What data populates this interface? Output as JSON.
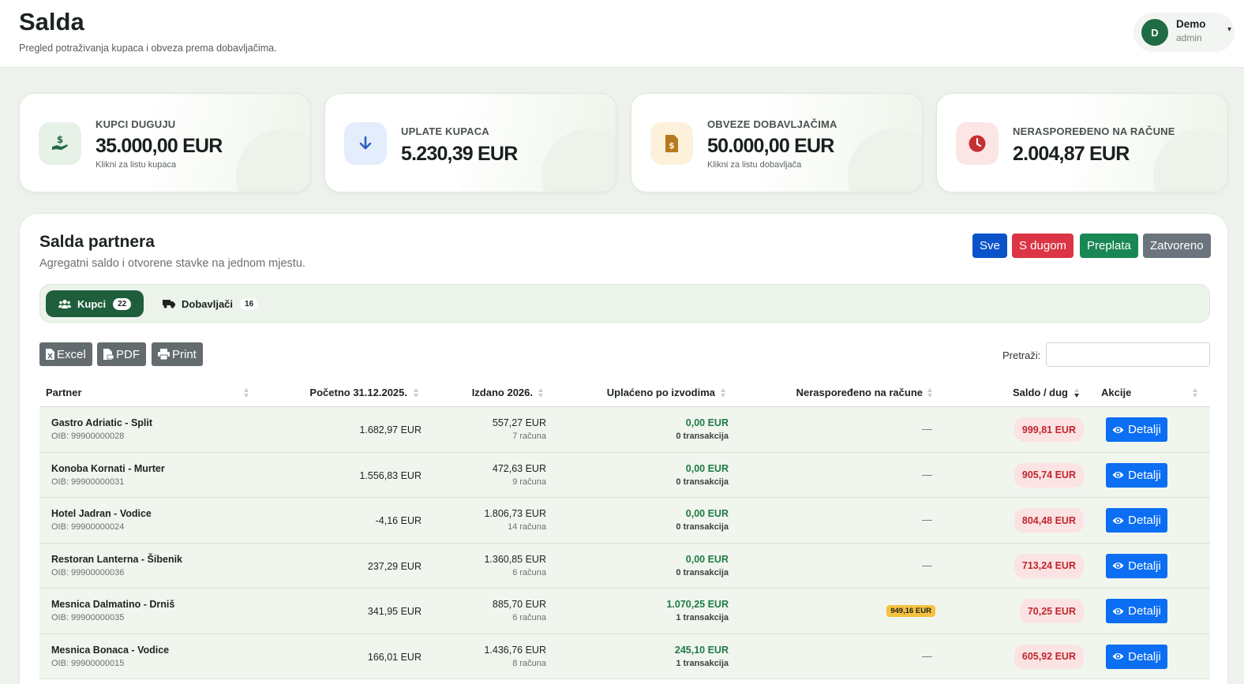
{
  "header": {
    "title": "Salda",
    "subtitle": "Pregled potraživanja kupaca i obveza prema dobavljačima."
  },
  "user": {
    "initial": "D",
    "name": "Demo",
    "role": "admin"
  },
  "stats": [
    {
      "label": "KUPCI DUGUJU",
      "value": "35.000,00 EUR",
      "hint": "Klikni za listu kupaca",
      "icon": "hand-dollar-icon",
      "color": "#1f6b45"
    },
    {
      "label": "UPLATE KUPACA",
      "value": "5.230,39 EUR",
      "hint": "",
      "icon": "arrow-down-icon",
      "color": "#2f5fc4"
    },
    {
      "label": "OBVEZE DOBAVLJAČIMA",
      "value": "50.000,00 EUR",
      "hint": "Klikni za listu dobavljača",
      "icon": "invoice-dollar-icon",
      "color": "#b7791f"
    },
    {
      "label": "NERASPOREĐENO NA RAČUNE",
      "value": "2.004,87 EUR",
      "hint": "",
      "icon": "clock-icon",
      "color": "#c53030"
    }
  ],
  "panel": {
    "title": "Salda partnera",
    "subtitle": "Agregatni saldo i otvorene stavke na jednom mjestu."
  },
  "filters": {
    "all": "Sve",
    "debt": "S dugom",
    "overpaid": "Preplata",
    "closed": "Zatvoreno"
  },
  "tabs": {
    "customers": {
      "label": "Kupci",
      "count": "22"
    },
    "suppliers": {
      "label": "Dobavljači",
      "count": "16"
    }
  },
  "export": {
    "excel": "Excel",
    "pdf": "PDF",
    "print": "Print"
  },
  "search": {
    "label": "Pretraži:",
    "value": ""
  },
  "table": {
    "columns": {
      "partner": "Partner",
      "initial": "Početno 31.12.2025.",
      "issued": "Izdano 2026.",
      "paid": "Uplaćeno po izvodima",
      "unassigned": "Neraspoređeno na račune",
      "saldo": "Saldo / dug",
      "actions": "Akcije"
    },
    "details_label": "Detalji",
    "rows": [
      {
        "name": "Gastro Adriatic - Split",
        "oib": "OIB: 99900000028",
        "initial": "1.682,97 EUR",
        "issued": "557,27 EUR",
        "issued_count": "7 računa",
        "paid": "0,00 EUR",
        "paid_count": "0 transakcija",
        "unassigned": "—",
        "saldo": "999,81 EUR"
      },
      {
        "name": "Konoba Kornati - Murter",
        "oib": "OIB: 99900000031",
        "initial": "1.556,83 EUR",
        "issued": "472,63 EUR",
        "issued_count": "9 računa",
        "paid": "0,00 EUR",
        "paid_count": "0 transakcija",
        "unassigned": "—",
        "saldo": "905,74 EUR"
      },
      {
        "name": "Hotel Jadran - Vodice",
        "oib": "OIB: 99900000024",
        "initial": "-4,16 EUR",
        "issued": "1.806,73 EUR",
        "issued_count": "14 računa",
        "paid": "0,00 EUR",
        "paid_count": "0 transakcija",
        "unassigned": "—",
        "saldo": "804,48 EUR"
      },
      {
        "name": "Restoran Lanterna - Šibenik",
        "oib": "OIB: 99900000036",
        "initial": "237,29 EUR",
        "issued": "1.360,85 EUR",
        "issued_count": "6 računa",
        "paid": "0,00 EUR",
        "paid_count": "0 transakcija",
        "unassigned": "—",
        "saldo": "713,24 EUR"
      },
      {
        "name": "Mesnica Dalmatino - Drniš",
        "oib": "OIB: 99900000035",
        "initial": "341,95 EUR",
        "issued": "885,70 EUR",
        "issued_count": "6 računa",
        "paid": "1.070,25 EUR",
        "paid_count": "1 transakcija",
        "unassigned": "949,16 EUR",
        "saldo": "70,25 EUR"
      },
      {
        "name": "Mesnica Bonaca - Vodice",
        "oib": "OIB: 99900000015",
        "initial": "166,01 EUR",
        "issued": "1.436,76 EUR",
        "issued_count": "8 računa",
        "paid": "245,10 EUR",
        "paid_count": "1 transakcija",
        "unassigned": "—",
        "saldo": "605,92 EUR"
      }
    ]
  },
  "colors": {
    "primary_green": "#1f5e3c",
    "danger": "#dc3545",
    "success": "#198754",
    "info": "#0b53c9",
    "secondary": "#6c757d",
    "details_blue": "#0b6ef3"
  }
}
